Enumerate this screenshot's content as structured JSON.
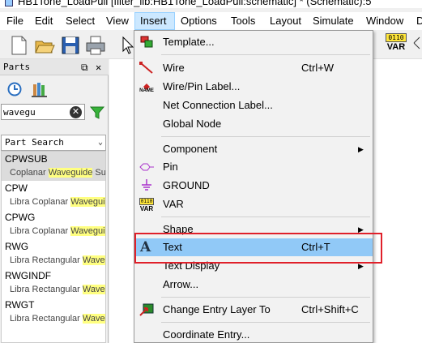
{
  "window": {
    "title": "HB1Tone_LoadPull [filter_lib:HB1Tone_LoadPull:schematic] * (Schematic):5"
  },
  "menubar": {
    "items": [
      {
        "label": "File"
      },
      {
        "label": "Edit"
      },
      {
        "label": "Select"
      },
      {
        "label": "View"
      },
      {
        "label": "Insert"
      },
      {
        "label": "Options"
      },
      {
        "label": "Tools"
      },
      {
        "label": "Layout"
      },
      {
        "label": "Simulate"
      },
      {
        "label": "Window"
      },
      {
        "label": "D"
      }
    ]
  },
  "toolbar": {
    "var_badge_top": "0110",
    "var_badge_bottom": "VAR"
  },
  "parts_panel": {
    "title": "Parts",
    "search_value": "wavegu",
    "clear_glyph": "✕",
    "part_search_label": "Part Search",
    "items": [
      {
        "name": "CPWSUB",
        "desc_pre": "Coplanar ",
        "desc_hl": "Waveguide",
        "desc_post": " Su"
      },
      {
        "name": "CPW",
        "desc_pre": "Libra Coplanar ",
        "desc_hl": "Waveguid",
        "desc_post": ""
      },
      {
        "name": "CPWG",
        "desc_pre": "Libra Coplanar ",
        "desc_hl": "Waveguid",
        "desc_post": ""
      },
      {
        "name": "RWG",
        "desc_pre": "Libra Rectangular ",
        "desc_hl": "Wave",
        "desc_post": ""
      },
      {
        "name": "RWGINDF",
        "desc_pre": "Libra Rectangular ",
        "desc_hl": "Wave",
        "desc_post": ""
      },
      {
        "name": "RWGT",
        "desc_pre": "Libra Rectangular ",
        "desc_hl": "Wave",
        "desc_post": ""
      }
    ]
  },
  "insert_menu": {
    "template": "Template...",
    "wire": "Wire",
    "wire_sc": "Ctrl+W",
    "wire_pin_label": "Wire/Pin Label...",
    "name_icon_text": "NAME",
    "net_connection_label": "Net Connection Label...",
    "global_node": "Global Node",
    "component": "Component",
    "pin": "Pin",
    "ground": "GROUND",
    "var": "VAR",
    "var_icon_top": "0110",
    "var_icon_bottom": "VAR",
    "shape": "Shape",
    "text": "Text",
    "text_sc": "Ctrl+T",
    "text_display": "Text Display",
    "arrow": "Arrow...",
    "change_entry_layer": "Change Entry Layer To",
    "change_entry_layer_sc": "Ctrl+Shift+C",
    "coordinate_entry": "Coordinate Entry..."
  },
  "colors": {
    "hover": "#91c9f7",
    "highlight": "#ffff80",
    "red_box": "#e0202a"
  }
}
